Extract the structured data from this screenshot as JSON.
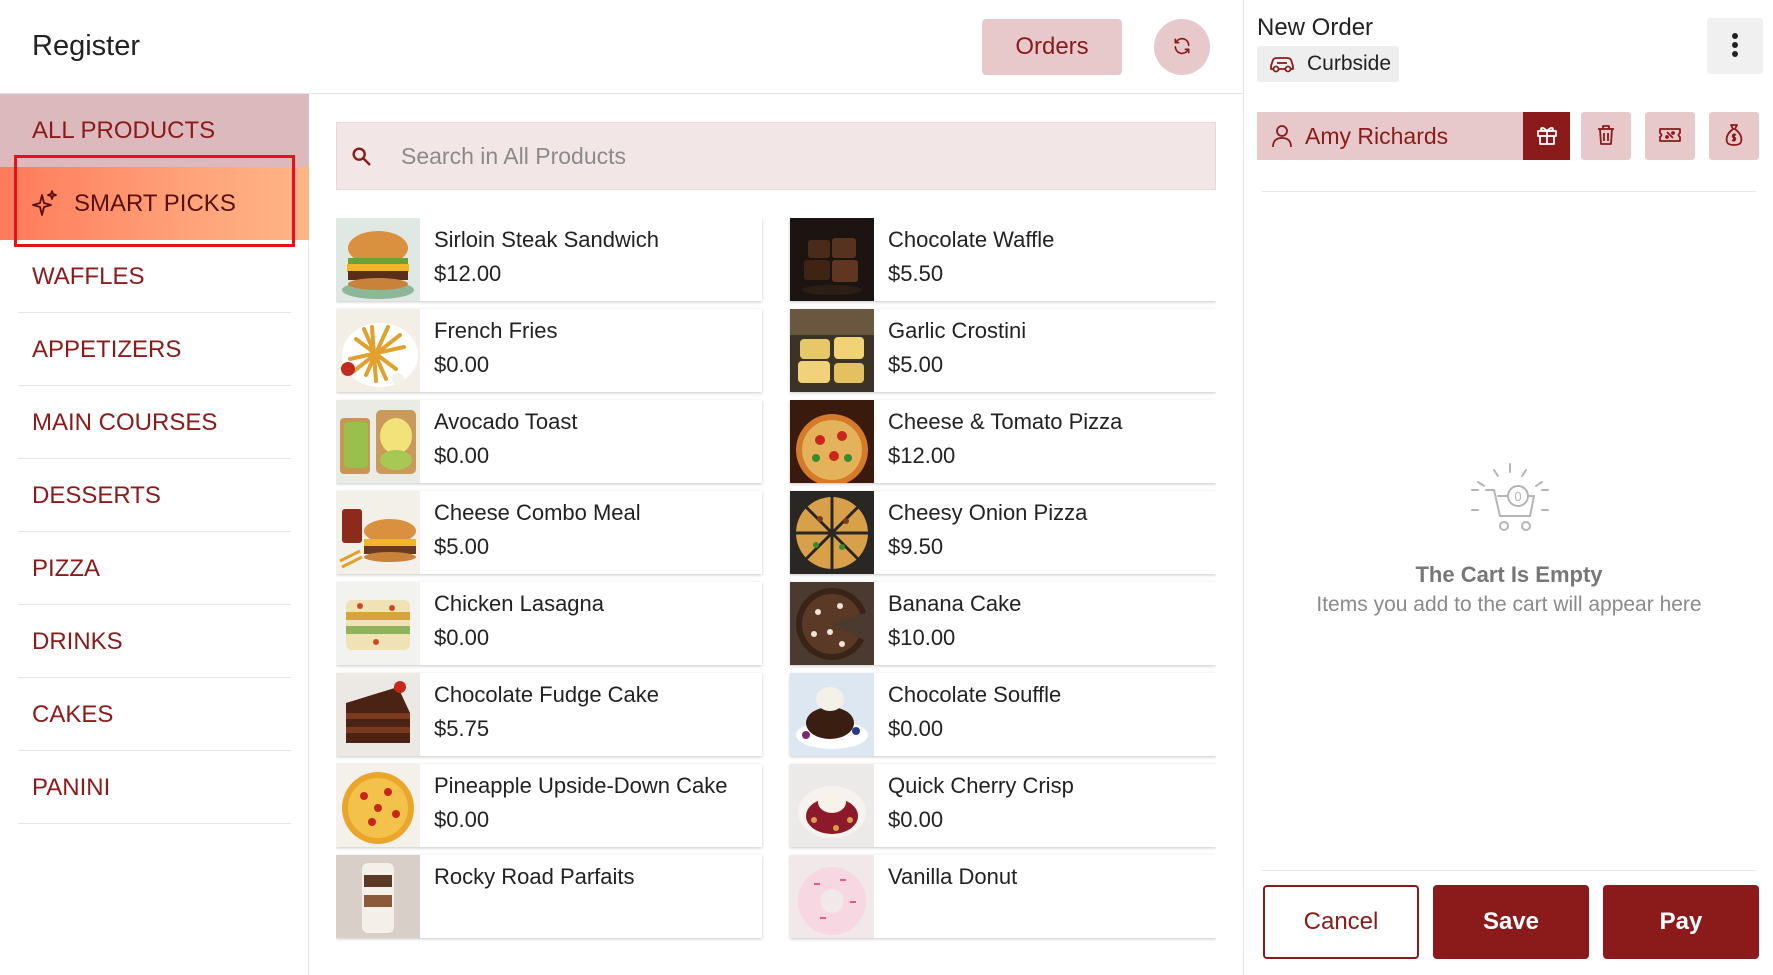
{
  "header": {
    "title": "Register",
    "orders_label": "Orders"
  },
  "sidebar": {
    "categories": [
      {
        "label": "ALL PRODUCTS"
      },
      {
        "label": "SMART PICKS"
      },
      {
        "label": "WAFFLES"
      },
      {
        "label": "APPETIZERS"
      },
      {
        "label": "MAIN COURSES"
      },
      {
        "label": "DESSERTS"
      },
      {
        "label": "PIZZA"
      },
      {
        "label": "DRINKS"
      },
      {
        "label": "CAKES"
      },
      {
        "label": "PANINI"
      }
    ]
  },
  "search": {
    "placeholder": "Search in All Products"
  },
  "products": [
    {
      "name": "Sirloin Steak Sandwich",
      "price": "$12.00",
      "icon": "burger-image"
    },
    {
      "name": "Chocolate Waffle",
      "price": "$5.50",
      "icon": "waffle-image"
    },
    {
      "name": "French Fries",
      "price": "$0.00",
      "icon": "fries-image"
    },
    {
      "name": "Garlic Crostini",
      "price": "$5.00",
      "icon": "crostini-image"
    },
    {
      "name": "Avocado Toast",
      "price": "$0.00",
      "icon": "toast-image"
    },
    {
      "name": "Cheese & Tomato Pizza",
      "price": "$12.00",
      "icon": "pizza-image"
    },
    {
      "name": "Cheese Combo Meal",
      "price": "$5.00",
      "icon": "combo-image"
    },
    {
      "name": "Cheesy Onion Pizza",
      "price": "$9.50",
      "icon": "pizza-image"
    },
    {
      "name": "Chicken Lasagna",
      "price": "$0.00",
      "icon": "lasagna-image"
    },
    {
      "name": "Banana Cake",
      "price": "$10.00",
      "icon": "cake-image"
    },
    {
      "name": "Chocolate Fudge Cake",
      "price": "$5.75",
      "icon": "cake-slice-image"
    },
    {
      "name": "Chocolate Souffle",
      "price": "$0.00",
      "icon": "souffle-image"
    },
    {
      "name": "Pineapple Upside-Down Cake",
      "price": "$0.00",
      "icon": "pineapple-cake-image"
    },
    {
      "name": "Quick Cherry Crisp",
      "price": "$0.00",
      "icon": "cherry-crisp-image"
    },
    {
      "name": "Rocky Road Parfaits",
      "price": "",
      "icon": "parfait-image"
    },
    {
      "name": "Vanilla Donut",
      "price": "",
      "icon": "donut-image"
    }
  ],
  "order": {
    "title": "New Order",
    "mode": "Curbside",
    "customer": "Amy Richards",
    "empty_title": "The Cart Is Empty",
    "empty_subtitle": "Items you add to the cart will appear here",
    "cart_count": "0",
    "cancel_label": "Cancel",
    "save_label": "Save",
    "pay_label": "Pay"
  },
  "colors": {
    "brand": "#8b1a1a",
    "brand_light": "#e8c9cb",
    "smart_picks_start": "#ff7a5a",
    "smart_picks_end": "#ffb585",
    "highlight": "#e8111b"
  }
}
